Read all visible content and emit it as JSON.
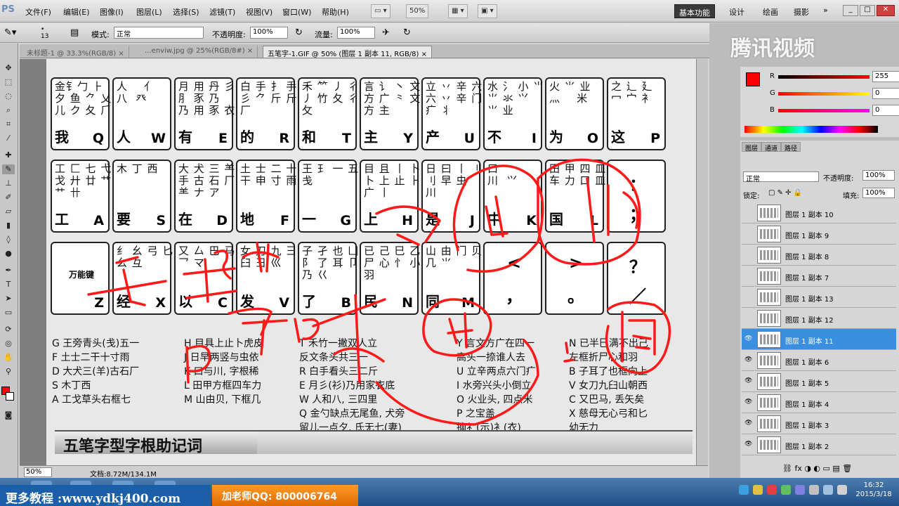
{
  "app": {
    "logo": "PS"
  },
  "menu": [
    "文件(F)",
    "编辑(E)",
    "图像(I)",
    "图层(L)",
    "选择(S)",
    "滤镜(T)",
    "视图(V)",
    "窗口(W)",
    "帮助(H)"
  ],
  "menubar": {
    "zoom": "50%",
    "workspaces": [
      "基本功能",
      "设计",
      "绘画",
      "摄影"
    ]
  },
  "options": {
    "mode_label": "模式:",
    "mode_value": "正常",
    "opacity_label": "不透明度:",
    "opacity_value": "100%",
    "flow_label": "流量:",
    "flow_value": "100%"
  },
  "tabs": [
    {
      "label": "未标题-1 @ 33.3%(RGB/8) ×",
      "active": false
    },
    {
      "label": "...enviw.jpg @ 25%(RGB/8#) ×",
      "active": false
    },
    {
      "label": "五笔字-1.GIF @ 50% (图层 1 副本 11, RGB/8) ×",
      "active": true
    }
  ],
  "keys_row1": [
    {
      "rad": "金钅勹 ⺊\n夕 鱼 ⺈ 乂\n儿 ク 夂 ⺁",
      "char": "我",
      "letter": "Q"
    },
    {
      "rad": "人    亻\n八  癶",
      "char": "人",
      "letter": "W"
    },
    {
      "rad": "月 用 丹 彡\n⺼ 豕 乃\n乃 用 豕 衣",
      "char": "有",
      "letter": "E"
    },
    {
      "rad": "白 手 ⺘ 手\n彡 ⺈ 斤 斤\n厂",
      "char": "的",
      "letter": "R"
    },
    {
      "rad": "禾 ⺮ 丿 彳\n丿 竹 夂 彳\n攵",
      "char": "和",
      "letter": "T"
    },
    {
      "rad": "言 讠 丶 文\n方 广 ⺀ 文\n方 主",
      "char": "主",
      "letter": "Y"
    },
    {
      "rad": "立 丷 辛 六\n六 丷 辛 门\n疒 丬",
      "char": "产",
      "letter": "U"
    },
    {
      "rad": "水 氵 小 ⺌\n⺌ 氺 ⺍\n⺌ 业",
      "char": "不",
      "letter": "I"
    },
    {
      "rad": "火 ⺌ 业\n灬    米",
      "char": "为",
      "letter": "O"
    },
    {
      "rad": "之 辶 廴\n冖 宀 衤",
      "char": "这",
      "letter": "P"
    }
  ],
  "keys_row2": [
    {
      "rad": "工 匚 七 弋\n戈 廾 廿 艹\n⺾ 卄",
      "char": "工",
      "letter": "A"
    },
    {
      "rad": "木 丁 西",
      "char": "要",
      "letter": "S"
    },
    {
      "rad": "大 犬 三 ⺷\n手 古 石 厂\n⺷ ナ ア",
      "char": "在",
      "letter": "D"
    },
    {
      "rad": "土 士 二 十\n干 申 寸 雨",
      "char": "地",
      "letter": "F"
    },
    {
      "rad": "王 ⺩ 一 五\n戋",
      "char": "一",
      "letter": "G"
    },
    {
      "rad": "目 且 丨 卜\n卜 上 止 ⺊\n广 丨",
      "char": "上",
      "letter": "H"
    },
    {
      "rad": "日 曰 丨 刂\n刂 早 虫\n川",
      "char": "是",
      "letter": "J"
    },
    {
      "rad": "口\n川  ⺍",
      "char": "中",
      "letter": "K"
    },
    {
      "rad": "田 甲 四 皿\n车 力 口 皿",
      "char": "国",
      "letter": "L"
    },
    {
      "punct_top": "：",
      "punct_bot": "；"
    }
  ],
  "keys_row3": [
    {
      "mid": "万能键",
      "char": "",
      "letter": "Z"
    },
    {
      "rad": "纟 幺 弓 匕\n幺 彑",
      "char": "经",
      "letter": "X"
    },
    {
      "rad": "又 厶 巴 马\n乛 マ",
      "char": "以",
      "letter": "C"
    },
    {
      "rad": "女 刀 九 彐\n臼 彐 巛",
      "char": "发",
      "letter": "V"
    },
    {
      "rad": "子 孑 也 凵\n阝 了 耳 卩\n乃 巜",
      "char": "了",
      "letter": "B"
    },
    {
      "rad": "已 己 巳 乙\n尸 心 忄 小\n羽",
      "char": "民",
      "letter": "N"
    },
    {
      "rad": "山 由 门 贝\n几 ⺌",
      "char": "同",
      "letter": "M"
    },
    {
      "punct_top": "<",
      "punct_bot": "，"
    },
    {
      "punct_top": ">",
      "punct_bot": "。"
    },
    {
      "punct_top": "？",
      "punct_bot": "／"
    }
  ],
  "mnemonics_col1": [
    "G  王旁青头(戋)五一",
    "F  土士二干十寸雨",
    "D  大犬三(羊)古石厂",
    "S  木丁西",
    "A  工戈草头右框七"
  ],
  "mnemonics_col2": [
    "H  目具上止卜虎皮",
    "J  日早两竖与虫依",
    "K  口与川, 字根稀",
    "L  田甲方框四车力",
    "M  山由贝, 下框几"
  ],
  "mnemonics_col3": [
    "T  禾竹一撇双人立",
    "    反文条头共三一",
    "R  白手看头三二斤",
    "E  月彡(衫)乃用家衣底",
    "W  人和八, 三四里",
    "Q  金勺缺点无尾鱼, 犬旁",
    "    留儿一点夕, 氏无七(妻)"
  ],
  "mnemonics_col4": [
    "Y  言文方广在四一",
    "    高头一捺谁人去",
    "U  立辛两点六门疒",
    "I  水旁兴头小倒立",
    "O  火业头, 四点米",
    "P  之宝盖",
    "    摘礻(示)衤(衣)"
  ],
  "mnemonics_col5": [
    "N  已半巳满不出己",
    "    左框折尸心和羽",
    "B  子耳了也框向上",
    "V  女刀九臼山朝西",
    "C  又巴马, 丢矢矣",
    "X  慈母无心弓和匕",
    "    幼无力"
  ],
  "banner": "五笔字型字根助记词",
  "status": {
    "zoom": "50%",
    "doc": "文档:8.72M/134.1M"
  },
  "color_panel": {
    "r": "255",
    "g": "0",
    "b": "0",
    "r_lbl": "R",
    "g_lbl": "G",
    "b_lbl": "B"
  },
  "layers": {
    "tabs": [
      "图层",
      "通道",
      "路径"
    ],
    "blend": "正常",
    "opacity_label": "不透明度:",
    "opacity": "100%",
    "lock_label": "锁定:",
    "fill_label": "填充:",
    "fill": "100%",
    "items": [
      {
        "name": "图层 1 副本 10",
        "visible": false,
        "selected": false
      },
      {
        "name": "图层 1 副本 9",
        "visible": false,
        "selected": false
      },
      {
        "name": "图层 1 副本 8",
        "visible": false,
        "selected": false
      },
      {
        "name": "图层 1 副本 7",
        "visible": false,
        "selected": false
      },
      {
        "name": "图层 1 副本 13",
        "visible": false,
        "selected": false
      },
      {
        "name": "图层 1 副本 12",
        "visible": false,
        "selected": false
      },
      {
        "name": "图层 1 副本 11",
        "visible": true,
        "selected": true
      },
      {
        "name": "图层 1 副本 6",
        "visible": true,
        "selected": false
      },
      {
        "name": "图层 1 副本 5",
        "visible": true,
        "selected": false
      },
      {
        "name": "图层 1 副本 4",
        "visible": true,
        "selected": false
      },
      {
        "name": "图层 1 副本 3",
        "visible": true,
        "selected": false
      },
      {
        "name": "图层 1 副本 2",
        "visible": true,
        "selected": false
      }
    ]
  },
  "watermark": "腾讯视频",
  "promo": {
    "site": "更多教程 :www.ydkj400.com",
    "qq": "加老师QQ: 800006764"
  },
  "clock": {
    "time": "16:32",
    "date": "2015/3/18"
  },
  "colors": {
    "annotation": "#ff1a1a",
    "selection": "#3a8fe0",
    "promo_orange": "#f08a1a"
  }
}
